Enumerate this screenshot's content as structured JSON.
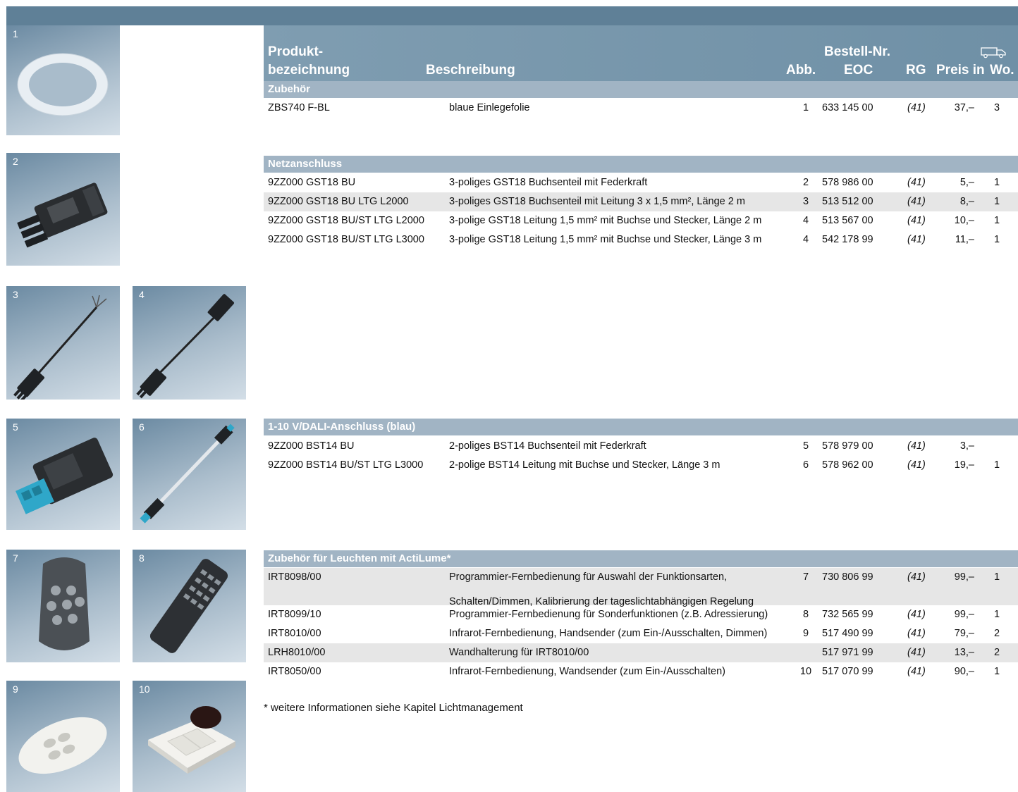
{
  "header": {
    "produkt_line1": "Produkt-",
    "produkt_line2": "bezeichnung",
    "beschreibung": "Beschreibung",
    "abb": "Abb.",
    "bestell_line1": "Bestell-Nr.",
    "bestell_line2": "EOC",
    "rg": "RG",
    "preis": "Preis in",
    "wo": "Wo.",
    "truck_icon": "delivery-truck-icon"
  },
  "sections": [
    {
      "title": "Zubehör",
      "rows": [
        {
          "name": "ZBS740 F-BL",
          "desc": "blaue Einlegefolie",
          "abb": "1",
          "eoc": "633 145 00",
          "rg": "(41)",
          "price": "37,–",
          "wo": "3"
        }
      ]
    },
    {
      "title": "Netzanschluss",
      "rows": [
        {
          "name": "9ZZ000 GST18 BU",
          "desc": "3-poliges GST18 Buchsenteil mit Federkraft",
          "abb": "2",
          "eoc": "578 986 00",
          "rg": "(41)",
          "price": "5,–",
          "wo": "1"
        },
        {
          "name": "9ZZ000 GST18 BU LTG L2000",
          "desc": "3-poliges GST18 Buchsenteil mit Leitung 3 x 1,5 mm², Länge 2 m",
          "abb": "3",
          "eoc": "513 512 00",
          "rg": "(41)",
          "price": "8,–",
          "wo": "1"
        },
        {
          "name": "9ZZ000 GST18 BU/ST LTG L2000",
          "desc": "3-polige GST18 Leitung 1,5 mm² mit Buchse und Stecker, Länge 2 m",
          "abb": "4",
          "eoc": "513 567 00",
          "rg": "(41)",
          "price": "10,–",
          "wo": "1"
        },
        {
          "name": "9ZZ000 GST18 BU/ST LTG L3000",
          "desc": "3-polige GST18 Leitung 1,5 mm² mit Buchse und Stecker, Länge 3 m",
          "abb": "4",
          "eoc": "542 178 99",
          "rg": "(41)",
          "price": "11,–",
          "wo": "1"
        }
      ]
    },
    {
      "title": "1-10 V/DALI-Anschluss (blau)",
      "rows": [
        {
          "name": "9ZZ000 BST14 BU",
          "desc": "2-poliges BST14 Buchsenteil mit Federkraft",
          "abb": "5",
          "eoc": "578 979 00",
          "rg": "(41)",
          "price": "3,–",
          "wo": ""
        },
        {
          "name": "9ZZ000 BST14 BU/ST LTG L3000",
          "desc": "2-polige BST14 Leitung mit Buchse und Stecker, Länge 3 m",
          "abb": "6",
          "eoc": "578 962 00",
          "rg": "(41)",
          "price": "19,–",
          "wo": "1"
        }
      ]
    },
    {
      "title": "Zubehör für Leuchten mit ActiLume*",
      "rows": [
        {
          "name": "IRT8098/00",
          "desc": "Programmier-Fernbedienung für Auswahl der Funktionsarten,",
          "desc_cont": "Schalten/Dimmen, Kalibrierung der tageslichtabhängigen Regelung",
          "abb": "7",
          "eoc": "730 806 99",
          "rg": "(41)",
          "price": "99,–",
          "wo": "1"
        },
        {
          "name": "IRT8099/10",
          "desc": "Programmier-Fernbedienung für Sonderfunktionen (z.B. Adressierung)",
          "abb": "8",
          "eoc": "732 565 99",
          "rg": "(41)",
          "price": "99,–",
          "wo": "1"
        },
        {
          "name": "IRT8010/00",
          "desc": "Infrarot-Fernbedienung, Handsender (zum Ein-/Ausschalten, Dimmen)",
          "abb": "9",
          "eoc": "517 490 99",
          "rg": "(41)",
          "price": "79,–",
          "wo": "2"
        },
        {
          "name": "LRH8010/00",
          "desc": "Wandhalterung für IRT8010/00",
          "abb": "",
          "eoc": "517 971 99",
          "rg": "(41)",
          "price": "13,–",
          "wo": "2"
        },
        {
          "name": "IRT8050/00",
          "desc": "Infrarot-Fernbedienung, Wandsender (zum Ein-/Ausschalten)",
          "abb": "10",
          "eoc": "517 070 99",
          "rg": "(41)",
          "price": "90,–",
          "wo": "1"
        }
      ]
    }
  ],
  "images": [
    "1",
    "2",
    "3",
    "4",
    "5",
    "6",
    "7",
    "8",
    "9",
    "10"
  ],
  "footnote": "* weitere Informationen siehe Kapitel Lichtmanagement"
}
